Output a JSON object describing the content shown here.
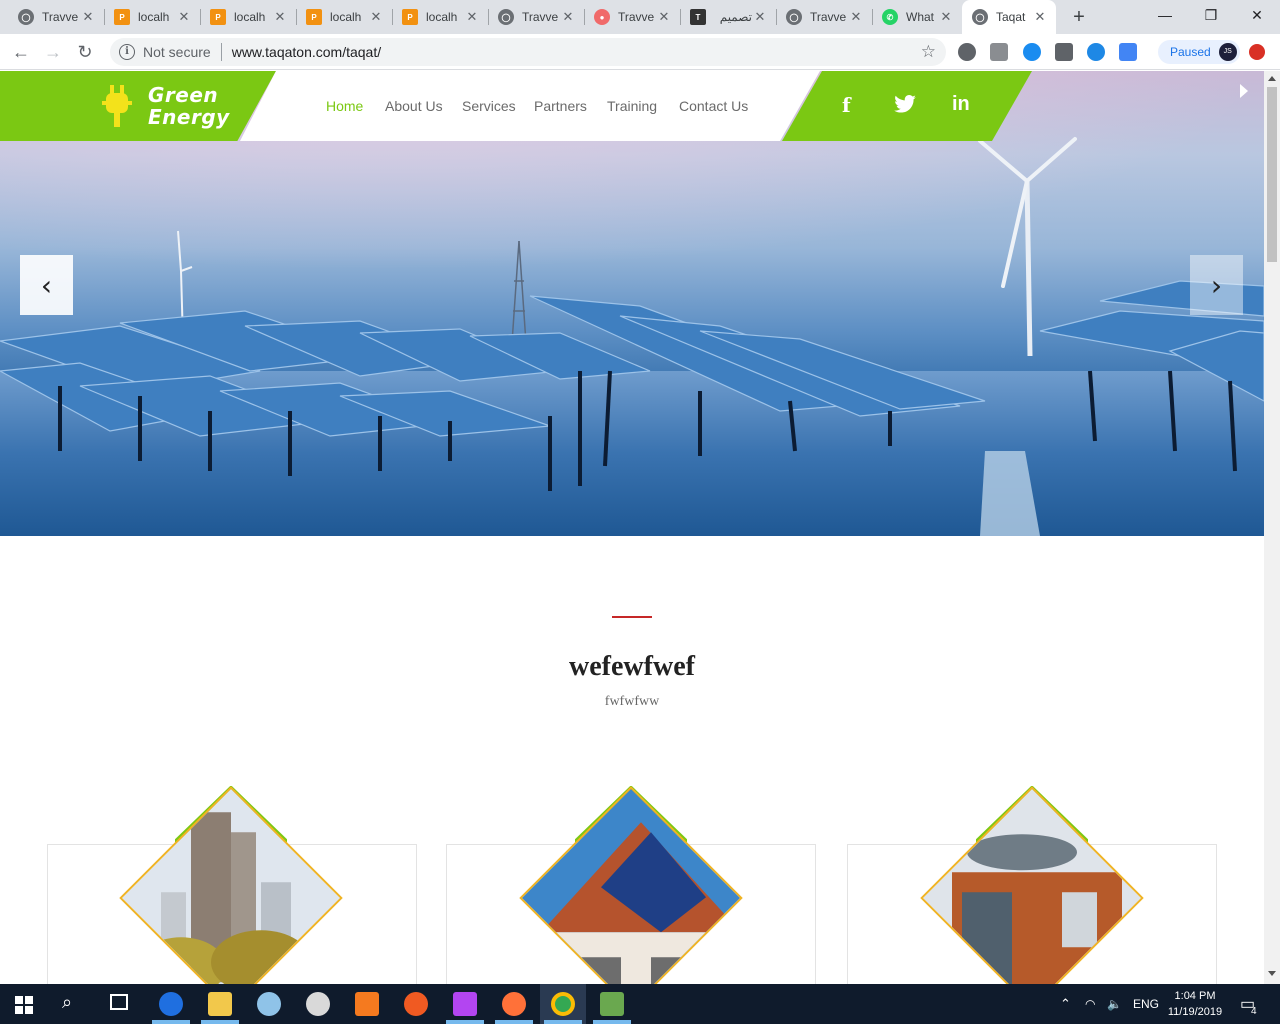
{
  "browser": {
    "tabs": [
      {
        "label": "Travve",
        "icon": "globe-icon"
      },
      {
        "label": "localh",
        "icon": "phpmyadmin-icon"
      },
      {
        "label": "localh",
        "icon": "phpmyadmin-icon"
      },
      {
        "label": "localh",
        "icon": "phpmyadmin-icon"
      },
      {
        "label": "localh",
        "icon": "phpmyadmin-icon"
      },
      {
        "label": "Travve",
        "icon": "globe-icon"
      },
      {
        "label": "Travve",
        "icon": "asana-icon"
      },
      {
        "label": "تصميم",
        "icon": "site-icon"
      },
      {
        "label": "Travve",
        "icon": "globe-icon"
      },
      {
        "label": "What",
        "icon": "whatsapp-icon"
      },
      {
        "label": "Taqat",
        "icon": "globe-icon",
        "active": true
      }
    ],
    "new_tab": "+",
    "window_controls": {
      "minimize": "—",
      "restore": "❐",
      "close": "✕"
    },
    "security_label": "Not secure",
    "url": "www.taqaton.com/taqat/",
    "profile_status": "Paused",
    "profile_initials": "JS"
  },
  "site": {
    "brand": {
      "line1": "Green",
      "line2": "Energy"
    },
    "nav": [
      {
        "label": "Home",
        "active": true
      },
      {
        "label": "About Us"
      },
      {
        "label": "Services"
      },
      {
        "label": "Partners"
      },
      {
        "label": "Training"
      },
      {
        "label": "Contact Us"
      }
    ],
    "social": {
      "facebook": "f",
      "twitter": "twitter-icon",
      "linkedin": "in"
    },
    "carousel": {
      "prev": "‹",
      "next": "›"
    },
    "section": {
      "title": "wefewfwef",
      "subtitle": "fwfwfww"
    },
    "cards": [
      {
        "image": "city-buildings-with-solar-panels"
      },
      {
        "image": "house-roof-with-solar-panels"
      },
      {
        "image": "modern-wooden-building"
      }
    ],
    "colors": {
      "accent": "#7bc813",
      "divider": "#c62828",
      "diamond_border": "#f0b323"
    }
  },
  "taskbar": {
    "language": "ENG",
    "time": "1:04 PM",
    "date": "11/19/2019",
    "notifications": "4"
  }
}
